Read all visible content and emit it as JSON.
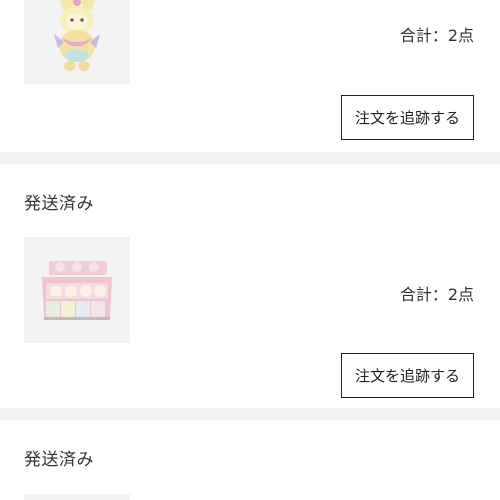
{
  "orders": [
    {
      "status": "",
      "total": "合計：2点",
      "track_label": "注文を追跡する",
      "image_icon": "plush-doll-icon"
    },
    {
      "status": "発送済み",
      "total": "合計：2点",
      "track_label": "注文を追跡する",
      "image_icon": "blind-box-set-icon"
    },
    {
      "status": "発送済み",
      "total": "",
      "track_label": "",
      "image_icon": "product-thumbnail-icon"
    }
  ]
}
